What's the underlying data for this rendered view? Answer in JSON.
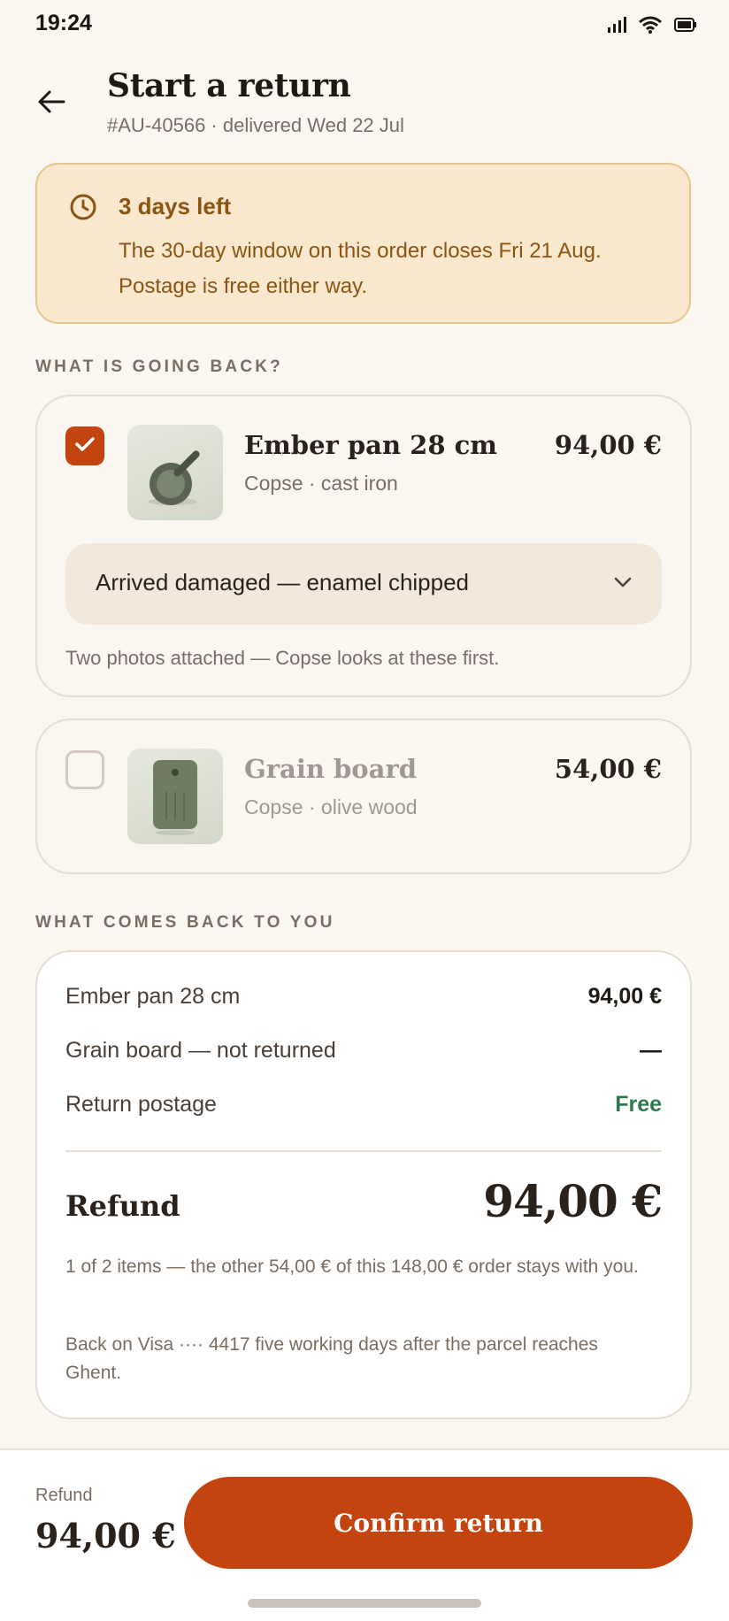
{
  "status_bar": {
    "time": "19:24",
    "icons": [
      "signal-icon",
      "wifi-icon",
      "battery-icon"
    ]
  },
  "header": {
    "title": "Start a return",
    "subtitle": "#AU-40566 · delivered Wed 22 Jul"
  },
  "alert": {
    "icon": "clock-icon",
    "title": "3 days left",
    "body": "The 30-day window on this order closes Fri 21 Aug. Postage is free either way."
  },
  "section_items": {
    "label": "WHAT IS GOING BACK?"
  },
  "items": [
    {
      "name": "Ember pan 28 cm",
      "sub": "Copse · cast iron",
      "price": "94,00 €",
      "checked": true,
      "reason": "Arrived damaged — enamel chipped",
      "note": "Two photos attached — Copse looks at these first."
    },
    {
      "name": "Grain board",
      "sub": "Copse · olive wood",
      "price": "54,00 €",
      "checked": false
    }
  ],
  "section_summary": {
    "label": "WHAT COMES BACK TO YOU"
  },
  "summary": {
    "rows": [
      {
        "label": "Ember pan 28 cm",
        "value": "94,00 €"
      },
      {
        "label": "Grain board — not returned",
        "value": "—"
      },
      {
        "label": "Return postage",
        "value": "Free"
      }
    ],
    "refund_label": "Refund",
    "refund_value": "94,00 €",
    "fine_1": "1 of 2 items — the other 54,00 € of this 148,00 € order stays with you.",
    "fine_2": "Back on Visa ···· 4417 five working days after the parcel reaches Ghent."
  },
  "bottom": {
    "label": "Refund",
    "total": "94,00 €",
    "confirm_label": "Confirm return"
  },
  "colors": {
    "accent": "#c4440f",
    "alert_bg": "#f9e8cd",
    "alert_text": "#8c5412",
    "free": "#2e7a4a"
  }
}
